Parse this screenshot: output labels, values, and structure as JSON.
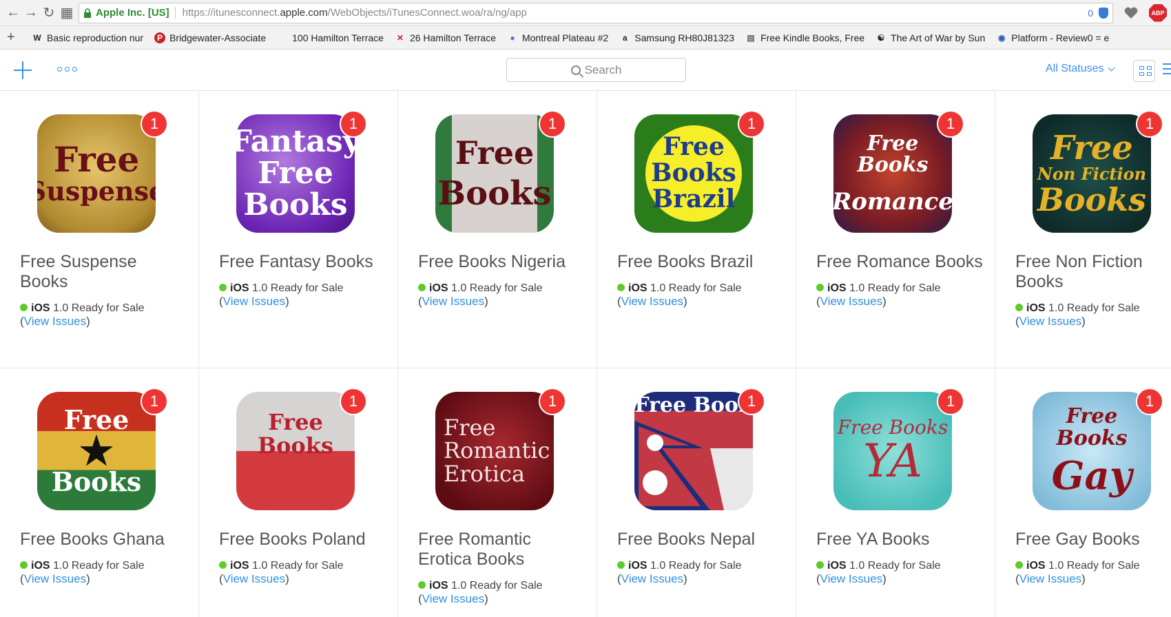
{
  "browser": {
    "org": "Apple Inc. [US]",
    "url_prefix": "https://itunesconnect.",
    "url_domain": "apple.com",
    "url_path": "/WebObjects/iTunesConnect.woa/ra/ng/app",
    "tracker_count": "0",
    "abp_label": "ABP"
  },
  "bookmarks": [
    {
      "icon": "W",
      "label": "Basic reproduction nur"
    },
    {
      "icon": "P",
      "label": "Bridgewater-Associate"
    },
    {
      "icon": "",
      "label": "100 Hamilton Terrace"
    },
    {
      "icon": "✕",
      "label": "26 Hamilton Terrace"
    },
    {
      "icon": "●",
      "label": "Montreal Plateau #2"
    },
    {
      "icon": "a",
      "label": "Samsung RH80J81323"
    },
    {
      "icon": "▤",
      "label": "Free Kindle Books, Free"
    },
    {
      "icon": "☯",
      "label": "The Art of War by Sun"
    },
    {
      "icon": "◉",
      "label": "Platform - Review0 = e"
    }
  ],
  "toolbar": {
    "search_placeholder": "Search",
    "status_filter": "All Statuses"
  },
  "status_common": {
    "platform": "iOS",
    "version_status": "1.0 Ready for Sale",
    "open_paren": "(",
    "view_issues": "View Issues",
    "close_paren": ")"
  },
  "apps": [
    {
      "name": "Free Suspense Books",
      "badge": "1",
      "icon_lines": [
        "Free",
        "Suspense"
      ]
    },
    {
      "name": "Free Fantasy Books",
      "badge": "1",
      "icon_lines": [
        "Fantasy",
        "Free",
        "Books"
      ]
    },
    {
      "name": "Free Books Nigeria",
      "badge": "1",
      "icon_lines": [
        "Free",
        "Books"
      ]
    },
    {
      "name": "Free Books Brazil",
      "badge": "1",
      "icon_lines": [
        "Free",
        "Books",
        "Brazil"
      ]
    },
    {
      "name": "Free Romance Books",
      "badge": "1",
      "icon_lines": [
        "Free Books",
        "Romance"
      ]
    },
    {
      "name": "Free Non Fiction Books",
      "badge": "1",
      "icon_lines": [
        "Free",
        "Non Fiction",
        "Books"
      ]
    },
    {
      "name": "Free Books Ghana",
      "badge": "1",
      "icon_lines": [
        "Free",
        "★",
        "Books"
      ]
    },
    {
      "name": "Free Books Poland",
      "badge": "1",
      "icon_lines": [
        "Free Books"
      ]
    },
    {
      "name": "Free Romantic Erotica Books",
      "badge": "1",
      "icon_lines": [
        "Free",
        "Romantic",
        "Erotica"
      ]
    },
    {
      "name": "Free Books Nepal",
      "badge": "1",
      "icon_lines": [
        "Free Book"
      ]
    },
    {
      "name": "Free YA Books",
      "badge": "1",
      "icon_lines": [
        "Free Books",
        "YA"
      ]
    },
    {
      "name": "Free Gay Books",
      "badge": "1",
      "icon_lines": [
        "Free Books",
        "Gay"
      ]
    }
  ]
}
